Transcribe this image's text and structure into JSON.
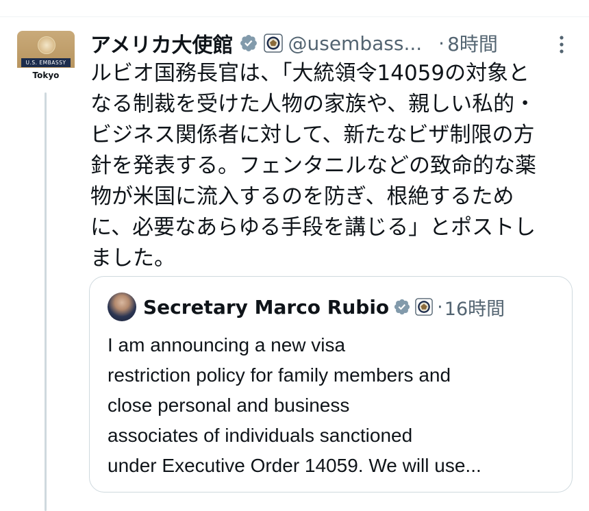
{
  "post": {
    "author": {
      "display_name": "アメリカ大使館",
      "handle": "@usembass...",
      "avatar_band_text": "U.S. EMBASSY",
      "avatar_city_text": "Tokyo",
      "verified_icon": "verified-badge-icon",
      "affiliation_icon": "state-department-seal-icon"
    },
    "separator": "·",
    "time": "8時間",
    "more_icon": "more-vertical-icon",
    "body": "ルビオ国務長官は、「大統領令14059の対象と\nなる制裁を受けた人物の家族や、親しい私的・\nビジネス関係者に対して、新たなビザ制限の方\n針を発表する。フェンタニルなどの致命的な薬\n物が米国に流入するのを防ぎ、根絶するため\nに、必要なあらゆる手段を講じる」とポストし\nました。",
    "quote": {
      "author_name": "Secretary Marco Rubio",
      "separator": "·",
      "time": "16時間",
      "verified_icon": "verified-badge-icon",
      "affiliation_icon": "state-department-seal-icon",
      "text": "I am announcing a new visa\nrestriction policy for family members and\nclose personal and business\nassociates of individuals sanctioned\nunder Executive Order 14059. We will use..."
    }
  },
  "colors": {
    "text_primary": "#0f1419",
    "text_secondary": "#536471",
    "verified_gray": "#829aab",
    "border": "#cfd9de",
    "background": "#ffffff"
  }
}
